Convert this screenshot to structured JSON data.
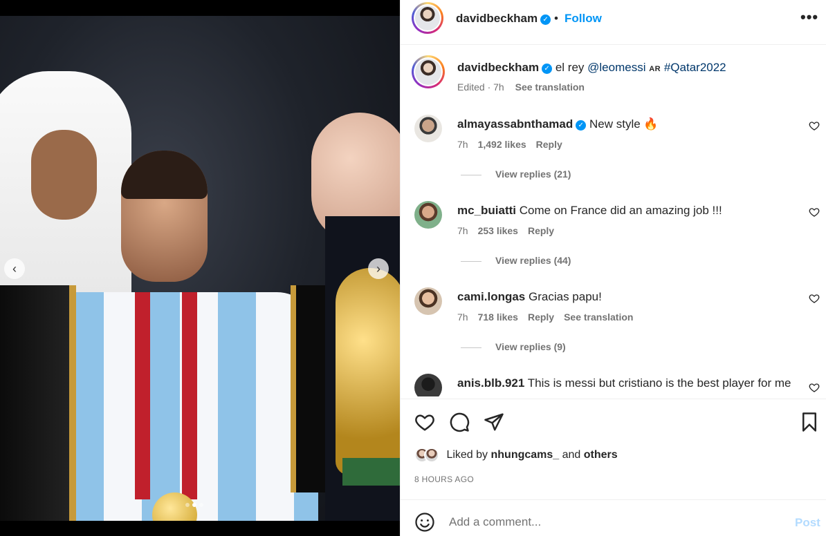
{
  "post": {
    "author": "davidbeckham",
    "follow_label": "Follow",
    "more_label": "•••",
    "carousel": {
      "prev_label": "‹",
      "next_label": "›",
      "slide_count": 3,
      "active_slide": 2
    }
  },
  "caption": {
    "user": "davidbeckham",
    "text_prefix": "el rey ",
    "mention": "@leomessi",
    "badge": "AR",
    "hashtag": "#Qatar2022",
    "edited_time": "Edited · 7h",
    "see_translation": "See translation"
  },
  "comments": [
    {
      "user": "almayassabnthamad",
      "verified": true,
      "text": "New style 🔥",
      "time": "7h",
      "likes": "1,492 likes",
      "reply": "Reply",
      "translation": "",
      "replies": "View replies (21)"
    },
    {
      "user": "mc_buiatti",
      "verified": false,
      "text": "Come on France did an amazing job !!!",
      "time": "7h",
      "likes": "253 likes",
      "reply": "Reply",
      "translation": "",
      "replies": "View replies (44)"
    },
    {
      "user": "cami.longas",
      "verified": false,
      "text": "Gracias papu!",
      "time": "7h",
      "likes": "718 likes",
      "reply": "Reply",
      "translation": "See translation",
      "replies": "View replies (9)"
    },
    {
      "user": "anis.blb.921",
      "verified": false,
      "text": "This is messi but cristiano is the best player for me",
      "time": "",
      "likes": "",
      "reply": "",
      "translation": "",
      "replies": ""
    }
  ],
  "likes_line": {
    "prefix": "Liked by ",
    "user": "nhungcams_",
    "middle": " and ",
    "others": "others"
  },
  "time_ago": "8 HOURS AGO",
  "add_comment": {
    "placeholder": "Add a comment...",
    "post_label": "Post"
  },
  "icons": [
    "heart-icon",
    "comment-icon",
    "share-icon",
    "bookmark-icon",
    "emoji-icon",
    "verified-icon",
    "more-icon"
  ],
  "colors": {
    "accent": "#0095f6",
    "text": "#262626",
    "muted": "#737373",
    "post_disabled": "#b3dbff"
  }
}
